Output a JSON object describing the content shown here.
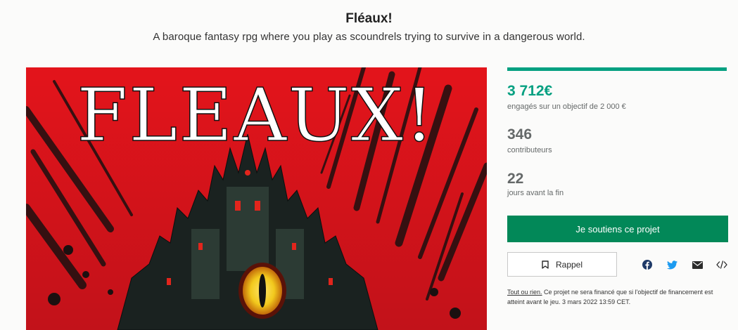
{
  "project": {
    "title": "Fléaux!",
    "blurb": "A baroque fantasy rpg where you play as scoundrels trying to survive in a dangerous world."
  },
  "hero": {
    "logo_text": "FLEAUX!",
    "palette": {
      "red": "#d8151c",
      "dark": "#141a18",
      "eye": "#f2c91d"
    }
  },
  "funding": {
    "progress_fraction": 1.0,
    "pledged": "3 712€",
    "pledged_label": "engagés sur un objectif de 2 000 €",
    "backers": "346",
    "backers_label": "contributeurs",
    "days": "22",
    "days_label": "jours avant la fin"
  },
  "actions": {
    "back_label": "Je soutiens ce projet",
    "remind_label": "Rappel",
    "share_icons": [
      "facebook-icon",
      "twitter-icon",
      "email-icon",
      "embed-icon"
    ]
  },
  "notice": {
    "link": "Tout ou rien.",
    "text": " Ce projet ne sera financé que si l'objectif de financement est atteint avant le jeu. 3 mars 2022 13:59 CET."
  },
  "colors": {
    "accent": "#05a081",
    "button": "#028858",
    "text_muted": "#656969"
  }
}
